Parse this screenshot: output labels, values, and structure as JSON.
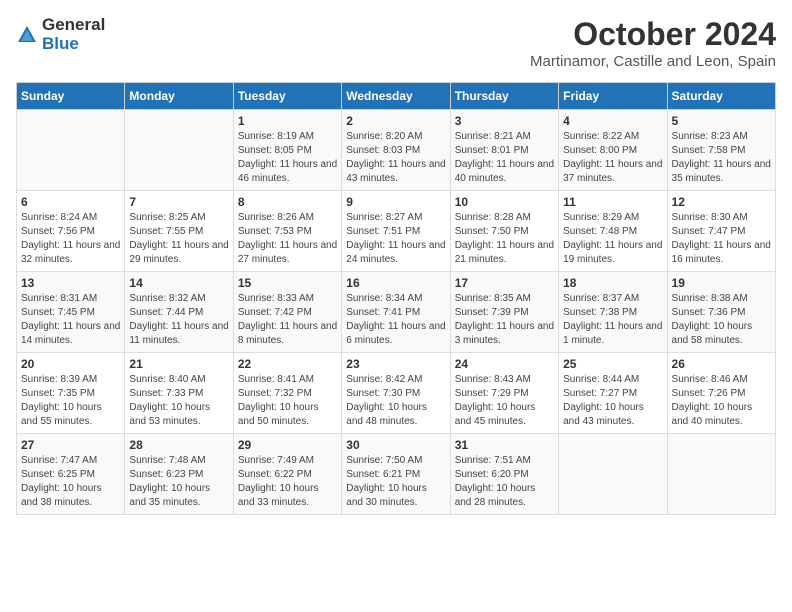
{
  "header": {
    "logo_general": "General",
    "logo_blue": "Blue",
    "title": "October 2024",
    "subtitle": "Martinamor, Castille and Leon, Spain"
  },
  "days_of_week": [
    "Sunday",
    "Monday",
    "Tuesday",
    "Wednesday",
    "Thursday",
    "Friday",
    "Saturday"
  ],
  "weeks": [
    [
      {
        "day": "",
        "content": ""
      },
      {
        "day": "",
        "content": ""
      },
      {
        "day": "1",
        "content": "Sunrise: 8:19 AM\nSunset: 8:05 PM\nDaylight: 11 hours and 46 minutes."
      },
      {
        "day": "2",
        "content": "Sunrise: 8:20 AM\nSunset: 8:03 PM\nDaylight: 11 hours and 43 minutes."
      },
      {
        "day": "3",
        "content": "Sunrise: 8:21 AM\nSunset: 8:01 PM\nDaylight: 11 hours and 40 minutes."
      },
      {
        "day": "4",
        "content": "Sunrise: 8:22 AM\nSunset: 8:00 PM\nDaylight: 11 hours and 37 minutes."
      },
      {
        "day": "5",
        "content": "Sunrise: 8:23 AM\nSunset: 7:58 PM\nDaylight: 11 hours and 35 minutes."
      }
    ],
    [
      {
        "day": "6",
        "content": "Sunrise: 8:24 AM\nSunset: 7:56 PM\nDaylight: 11 hours and 32 minutes."
      },
      {
        "day": "7",
        "content": "Sunrise: 8:25 AM\nSunset: 7:55 PM\nDaylight: 11 hours and 29 minutes."
      },
      {
        "day": "8",
        "content": "Sunrise: 8:26 AM\nSunset: 7:53 PM\nDaylight: 11 hours and 27 minutes."
      },
      {
        "day": "9",
        "content": "Sunrise: 8:27 AM\nSunset: 7:51 PM\nDaylight: 11 hours and 24 minutes."
      },
      {
        "day": "10",
        "content": "Sunrise: 8:28 AM\nSunset: 7:50 PM\nDaylight: 11 hours and 21 minutes."
      },
      {
        "day": "11",
        "content": "Sunrise: 8:29 AM\nSunset: 7:48 PM\nDaylight: 11 hours and 19 minutes."
      },
      {
        "day": "12",
        "content": "Sunrise: 8:30 AM\nSunset: 7:47 PM\nDaylight: 11 hours and 16 minutes."
      }
    ],
    [
      {
        "day": "13",
        "content": "Sunrise: 8:31 AM\nSunset: 7:45 PM\nDaylight: 11 hours and 14 minutes."
      },
      {
        "day": "14",
        "content": "Sunrise: 8:32 AM\nSunset: 7:44 PM\nDaylight: 11 hours and 11 minutes."
      },
      {
        "day": "15",
        "content": "Sunrise: 8:33 AM\nSunset: 7:42 PM\nDaylight: 11 hours and 8 minutes."
      },
      {
        "day": "16",
        "content": "Sunrise: 8:34 AM\nSunset: 7:41 PM\nDaylight: 11 hours and 6 minutes."
      },
      {
        "day": "17",
        "content": "Sunrise: 8:35 AM\nSunset: 7:39 PM\nDaylight: 11 hours and 3 minutes."
      },
      {
        "day": "18",
        "content": "Sunrise: 8:37 AM\nSunset: 7:38 PM\nDaylight: 11 hours and 1 minute."
      },
      {
        "day": "19",
        "content": "Sunrise: 8:38 AM\nSunset: 7:36 PM\nDaylight: 10 hours and 58 minutes."
      }
    ],
    [
      {
        "day": "20",
        "content": "Sunrise: 8:39 AM\nSunset: 7:35 PM\nDaylight: 10 hours and 55 minutes."
      },
      {
        "day": "21",
        "content": "Sunrise: 8:40 AM\nSunset: 7:33 PM\nDaylight: 10 hours and 53 minutes."
      },
      {
        "day": "22",
        "content": "Sunrise: 8:41 AM\nSunset: 7:32 PM\nDaylight: 10 hours and 50 minutes."
      },
      {
        "day": "23",
        "content": "Sunrise: 8:42 AM\nSunset: 7:30 PM\nDaylight: 10 hours and 48 minutes."
      },
      {
        "day": "24",
        "content": "Sunrise: 8:43 AM\nSunset: 7:29 PM\nDaylight: 10 hours and 45 minutes."
      },
      {
        "day": "25",
        "content": "Sunrise: 8:44 AM\nSunset: 7:27 PM\nDaylight: 10 hours and 43 minutes."
      },
      {
        "day": "26",
        "content": "Sunrise: 8:46 AM\nSunset: 7:26 PM\nDaylight: 10 hours and 40 minutes."
      }
    ],
    [
      {
        "day": "27",
        "content": "Sunrise: 7:47 AM\nSunset: 6:25 PM\nDaylight: 10 hours and 38 minutes."
      },
      {
        "day": "28",
        "content": "Sunrise: 7:48 AM\nSunset: 6:23 PM\nDaylight: 10 hours and 35 minutes."
      },
      {
        "day": "29",
        "content": "Sunrise: 7:49 AM\nSunset: 6:22 PM\nDaylight: 10 hours and 33 minutes."
      },
      {
        "day": "30",
        "content": "Sunrise: 7:50 AM\nSunset: 6:21 PM\nDaylight: 10 hours and 30 minutes."
      },
      {
        "day": "31",
        "content": "Sunrise: 7:51 AM\nSunset: 6:20 PM\nDaylight: 10 hours and 28 minutes."
      },
      {
        "day": "",
        "content": ""
      },
      {
        "day": "",
        "content": ""
      }
    ]
  ]
}
